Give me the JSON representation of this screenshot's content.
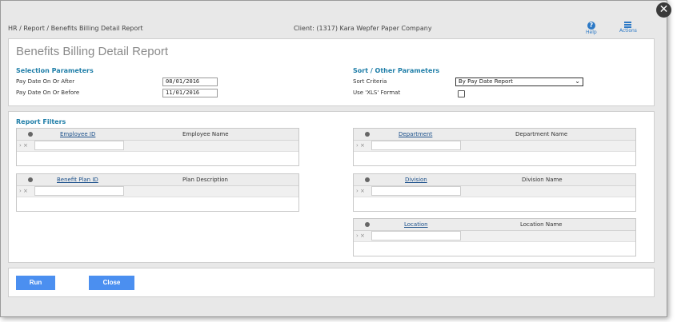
{
  "header": {
    "breadcrumb": "HR / Report / Benefits Billing Detail Report",
    "client": "Client: (1317) Kara Wepfer Paper Company",
    "help_label": "Help",
    "actions_label": "Actions"
  },
  "report": {
    "title": "Benefits Billing Detail Report",
    "selection_title": "Selection Parameters",
    "pay_after_label": "Pay Date On Or After",
    "pay_after_value": "08/01/2016",
    "pay_before_label": "Pay Date On Or Before",
    "pay_before_value": "11/01/2016",
    "sort_title": "Sort / Other Parameters",
    "sort_label": "Sort Criteria",
    "sort_value": "By Pay Date Report",
    "xls_label": "Use 'XLS' Format"
  },
  "filters": {
    "title": "Report Filters",
    "grids": [
      {
        "col1": "Employee ID",
        "col2": "Employee Name"
      },
      {
        "col1": "Benefit Plan ID",
        "col2": "Plan Description"
      },
      {
        "col1": "Department",
        "col2": "Department Name"
      },
      {
        "col1": "Division",
        "col2": "Division Name"
      },
      {
        "col1": "Location",
        "col2": "Location Name"
      }
    ],
    "row_controls": "› ×"
  },
  "footer": {
    "run_label": "Run",
    "close_label": "Close"
  }
}
